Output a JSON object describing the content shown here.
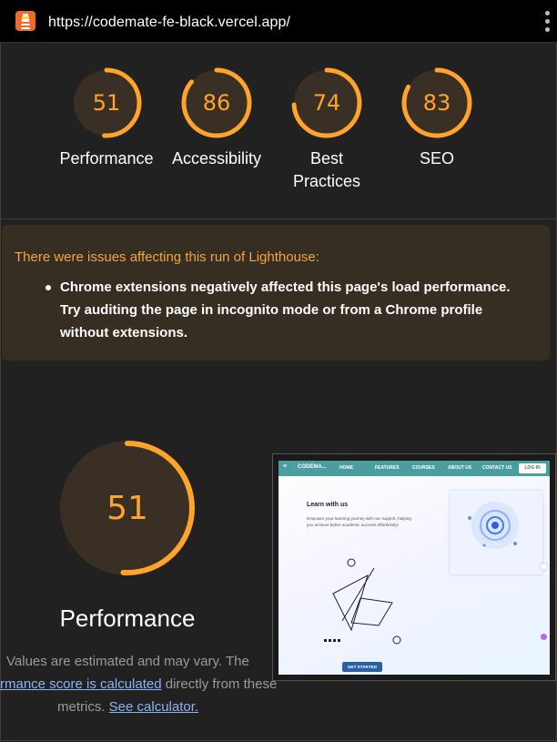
{
  "browser": {
    "url": "https://codemate-fe-black.vercel.app/",
    "logo_icon": "lighthouse-icon",
    "menu_icon": "kebab-menu-icon"
  },
  "colors": {
    "gauge_orange": "#ffa32a",
    "gauge_track": "#3a2f25",
    "warning_text": "#f5a53a",
    "link": "#8ab4f8"
  },
  "gauges": [
    {
      "value": "51",
      "label": "Performance",
      "score": 51
    },
    {
      "value": "86",
      "label": "Accessibility",
      "score": 86
    },
    {
      "value": "74",
      "label": "Best Practices",
      "score": 74
    },
    {
      "value": "83",
      "label": "SEO",
      "score": 83
    }
  ],
  "warning": {
    "title": "There were issues affecting this run of Lighthouse:",
    "item": "Chrome extensions negatively affected this page's load performance. Try auditing the page in incognito mode or from a Chrome profile without extensions."
  },
  "performance": {
    "value": "51",
    "score": 51,
    "label": "Performance",
    "note_start": "Values are estimated and may vary. The",
    "note_link1": "rmance score is calculated",
    "note_mid": "directly from these",
    "note_metrics": "metrics.",
    "note_link2": "See calculator."
  },
  "screenshot": {
    "brand": "CODEMA...",
    "nav": [
      "HOME",
      "FEATURES",
      "COURSES",
      "ABOUT US",
      "CONTACT US"
    ],
    "login": "LOG IN",
    "hero_title": "Learn with us",
    "hero_text": "Empower your learning journey with our support, helping you achieve better academic success effortlessly!",
    "cta": "GET STARTED"
  }
}
